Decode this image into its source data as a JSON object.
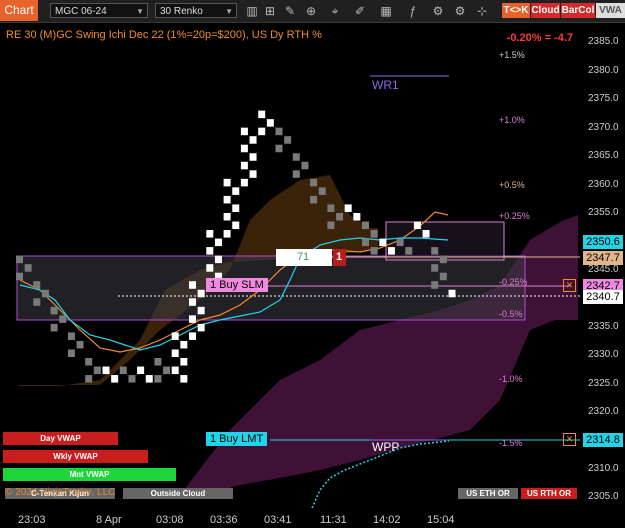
{
  "toolbar": {
    "chart_tab": "Chart",
    "instrument": "MGC 06-24",
    "period": "30 Renko",
    "trade_button": "T<>K",
    "cloud_button": "Cloud",
    "barcol_button": "BarCol",
    "vwap_button": "VWA"
  },
  "header": {
    "title": "RE 30 (M)GC Swing Ichi Dec 22 (1%=20p=$200), US Dy RTH %",
    "change": "-0.20% = -4.7"
  },
  "price_axis": {
    "ticks": [
      "2385.0",
      "2380.0",
      "2375.0",
      "2370.0",
      "2365.0",
      "2360.0",
      "2355.0",
      "2350.0",
      "2345.0",
      "2340.0",
      "2335.0",
      "2330.0",
      "2325.0",
      "2320.0",
      "2315.0",
      "2310.0",
      "2305.0"
    ],
    "tags": {
      "cyan": "2350.6",
      "tan": "2347.7",
      "orange": "2342.7",
      "white": "2340.7",
      "order": "2314.8"
    }
  },
  "time_axis": [
    "23:03",
    "8 Apr",
    "03:08",
    "03:36",
    "03:41",
    "11:31",
    "14:02",
    "15:04"
  ],
  "percent_levels": [
    "+1.5%",
    "+1.0%",
    "+0.5%",
    "+0.25%",
    "-0.25%",
    "-0.5%",
    "-1.0%",
    "-1.5%"
  ],
  "labels": {
    "wr1": "WR1",
    "wpp": "WPP",
    "buy_slm": "1 Buy SLM",
    "buy_lmt": "1 Buy LMT",
    "counter_value": "71",
    "counter_count": "1",
    "x_marker": "✕",
    "copyright": "© 2024 NinjaTrader, LLC"
  },
  "buttons": {
    "day_vwap": "Day VWAP",
    "wkly_vwap": "Wkly VWAP",
    "mnt_vwap": "Mnt VWAP",
    "tenkan_kijun": "C-Tenkan Kijun",
    "outside_cloud": "Outside Cloud",
    "us_eth_or": "US ETH OR",
    "us_rth_or": "US RTH OR"
  },
  "colors": {
    "accent": "#e8632b",
    "up_brick": "#ffffff",
    "down_brick": "#7a7a7a",
    "cyan": "#21d4e8",
    "orange": "#f28c28",
    "magenta": "#c236a6"
  },
  "chart_data": {
    "type": "renko",
    "brick_size": 1.5,
    "y_range": [
      2302.6,
      2388.4
    ],
    "columns": [
      {
        "dir": "down",
        "top": 2347.5,
        "bottom": 2343.0
      },
      {
        "dir": "down",
        "top": 2343.0,
        "bottom": 2338.5
      },
      {
        "dir": "down",
        "top": 2338.5,
        "bottom": 2334.0
      },
      {
        "dir": "down",
        "top": 2334.0,
        "bottom": 2329.5
      },
      {
        "dir": "down",
        "top": 2329.5,
        "bottom": 2325.0
      },
      {
        "dir": "up",
        "top": 2328.0,
        "bottom": 2325.0
      },
      {
        "dir": "down",
        "top": 2328.0,
        "bottom": 2325.0
      },
      {
        "dir": "up",
        "top": 2328.0,
        "bottom": 2325.0
      },
      {
        "dir": "down",
        "top": 2329.5,
        "bottom": 2325.0
      },
      {
        "dir": "up",
        "top": 2334.0,
        "bottom": 2325.0
      },
      {
        "dir": "up",
        "top": 2343.0,
        "bottom": 2332.5
      },
      {
        "dir": "up",
        "top": 2352.0,
        "bottom": 2341.5
      },
      {
        "dir": "up",
        "top": 2361.0,
        "bottom": 2350.5
      },
      {
        "dir": "up",
        "top": 2370.0,
        "bottom": 2359.5
      },
      {
        "dir": "up",
        "top": 2373.0,
        "bottom": 2368.5
      },
      {
        "dir": "down",
        "top": 2370.0,
        "bottom": 2365.5
      },
      {
        "dir": "down",
        "top": 2365.5,
        "bottom": 2361.0
      },
      {
        "dir": "down",
        "top": 2361.0,
        "bottom": 2356.5
      },
      {
        "dir": "down",
        "top": 2356.5,
        "bottom": 2352.0
      },
      {
        "dir": "up",
        "top": 2356.5,
        "bottom": 2353.5
      },
      {
        "dir": "down",
        "top": 2353.5,
        "bottom": 2347.5
      },
      {
        "dir": "up",
        "top": 2350.5,
        "bottom": 2347.5
      },
      {
        "dir": "down",
        "top": 2350.5,
        "bottom": 2347.5
      },
      {
        "dir": "up",
        "top": 2353.5,
        "bottom": 2350.5
      },
      {
        "dir": "down",
        "top": 2349.0,
        "bottom": 2341.5
      },
      {
        "dir": "up",
        "top": 2341.5,
        "bottom": 2340.7
      }
    ]
  }
}
